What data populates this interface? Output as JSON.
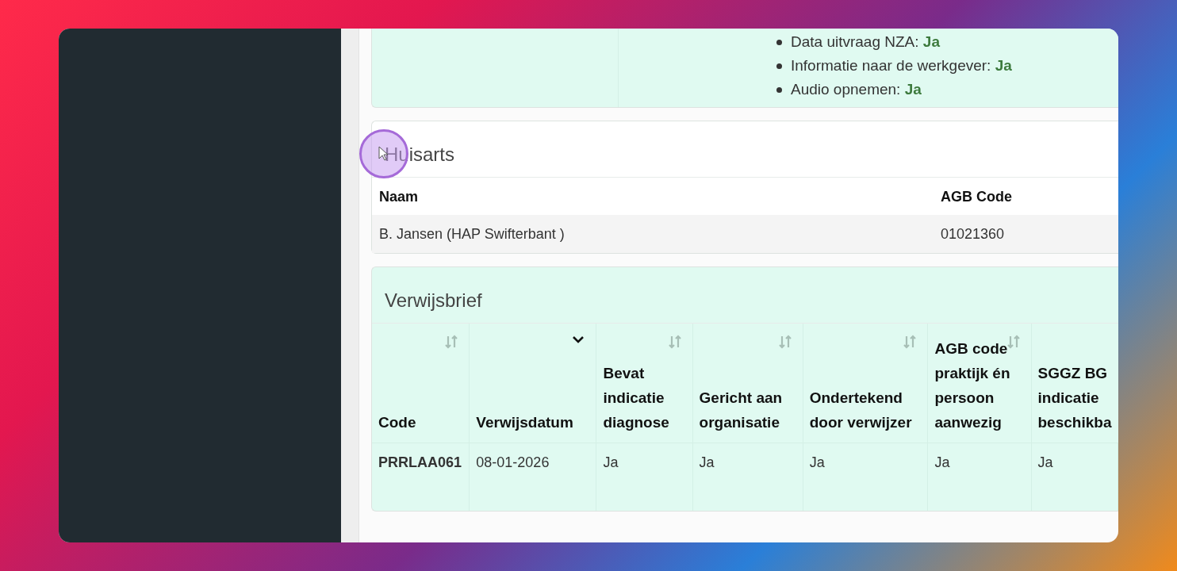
{
  "info_card": {
    "items": [
      {
        "label": "Data uitvraag NZA:",
        "value": "Ja"
      },
      {
        "label": "Informatie naar de werkgever:",
        "value": "Ja"
      },
      {
        "label": "Audio opnemen:",
        "value": "Ja"
      }
    ]
  },
  "huisarts": {
    "title": "Huisarts",
    "columns": [
      "Naam",
      "AGB Code"
    ],
    "rows": [
      [
        "B. Jansen (HAP Swifterbant )",
        "01021360"
      ]
    ]
  },
  "verwijsbrief": {
    "title": "Verwijsbrief",
    "columns": [
      {
        "label": "Code",
        "sorted": false
      },
      {
        "label": "Verwijsdatum",
        "sorted": true
      },
      {
        "label": "Bevat indicatie diagnose",
        "sorted": false
      },
      {
        "label": "Gericht aan organisatie",
        "sorted": false
      },
      {
        "label": "Ondertekend door verwijzer",
        "sorted": false
      },
      {
        "label": "AGB code praktijk én persoon aanwezig",
        "sorted": false
      },
      {
        "label": "SGGZ BG indicatie beschikba"
      }
    ],
    "rows": [
      [
        "PRRLAA061",
        "08-01-2026",
        "Ja",
        "Ja",
        "Ja",
        "Ja",
        "Ja"
      ]
    ]
  }
}
